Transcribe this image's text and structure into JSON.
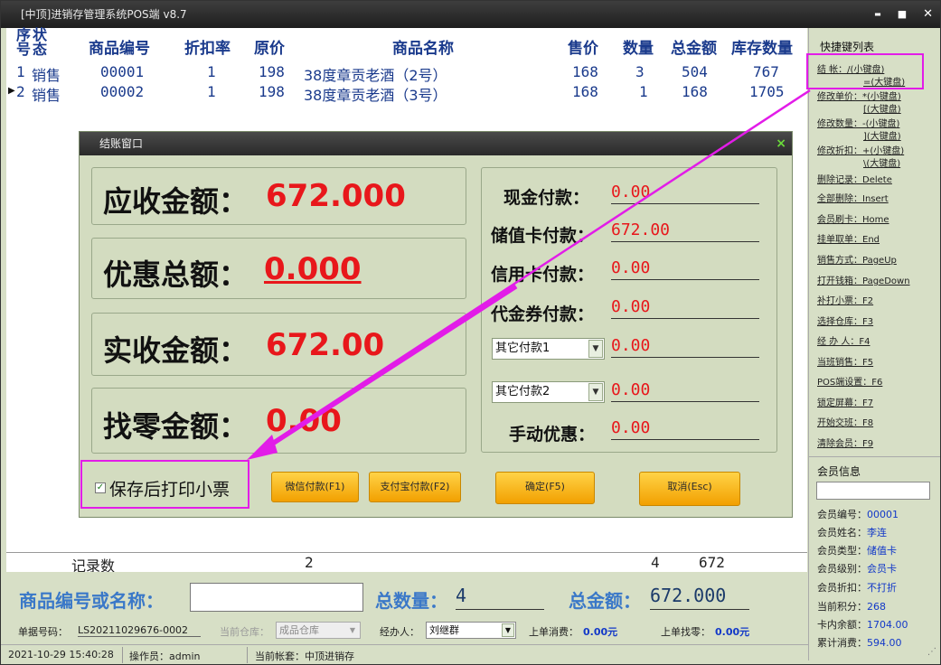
{
  "window": {
    "title": "[中顶]进销存管理系统POS端 v8.7",
    "min": "▬",
    "max": "■",
    "close": "✕"
  },
  "grid": {
    "headers": {
      "seq": "序号",
      "status": "状态",
      "code": "商品编号",
      "discount": "折扣率",
      "price": "原价",
      "name": "商品名称",
      "sale_price": "售价",
      "qty": "数量",
      "total": "总金额",
      "stock": "库存数量"
    },
    "rows": [
      {
        "seq": "1",
        "status": "销售",
        "code": "00001",
        "discount": "1",
        "price": "198",
        "name": "38度章贡老酒（2号）",
        "sale_price": "168",
        "qty": "3",
        "total": "504",
        "stock": "767"
      },
      {
        "seq": "2",
        "status": "销售",
        "code": "00002",
        "discount": "1",
        "price": "198",
        "name": "38度章贡老酒（3号）",
        "sale_price": "168",
        "qty": "1",
        "total": "168",
        "stock": "1705"
      }
    ],
    "footer": {
      "label": "记录数",
      "count": "2",
      "qty": "4",
      "total": "672"
    }
  },
  "dialog": {
    "title": "结账窗口",
    "close": "×",
    "receivable_label": "应收金额：",
    "receivable_value": "672.000",
    "discount_label": "优惠总额：",
    "discount_value": "0.000",
    "actual_label": "实收金额：",
    "actual_value": "672.00",
    "change_label": "找零金额：",
    "change_value": "0.00",
    "payments": [
      {
        "label": "现金付款：",
        "value": "0.00"
      },
      {
        "label": "储值卡付款：",
        "value": "672.00"
      },
      {
        "label": "信用卡付款：",
        "value": "0.00"
      },
      {
        "label": "代金券付款：",
        "value": "0.00"
      }
    ],
    "other1": {
      "select": "其它付款1",
      "value": "0.00"
    },
    "other2": {
      "select": "其它付款2",
      "value": "0.00"
    },
    "manual": {
      "label": "手动优惠：",
      "value": "0.00"
    },
    "print_checkbox": "保存后打印小票",
    "buttons": {
      "wechat": "微信付款(F1)",
      "alipay": "支付宝付款(F2)",
      "ok": "确定(F5)",
      "cancel": "取消(Esc)"
    }
  },
  "shortcuts": {
    "title": "快捷键列表",
    "items": [
      "结    帐：/(小键盘)",
      "=(大键盘)",
      "修改单价：*(小键盘)",
      "[(大键盘)",
      "修改数量：-(小键盘)",
      "](大键盘)",
      "修改折扣：+(小键盘)",
      "\\(大键盘)",
      "删除记录：Delete",
      "全部删除：Insert",
      "会员刷卡：Home",
      "挂单取单：End",
      "销售方式：PageUp",
      "打开钱箱：PageDown",
      "补打小票：F2",
      "选择仓库：F3",
      "经 办 人：F4",
      "当班销售：F5",
      "POS端设置：F6",
      "锁定屏幕：F7",
      "开始交班：F8",
      "清除会员：F9"
    ]
  },
  "member": {
    "title": "会员信息",
    "search_value": "",
    "fields": [
      {
        "label": "会员编号：",
        "value": "00001"
      },
      {
        "label": "会员姓名：",
        "value": "李连"
      },
      {
        "label": "会员类型：",
        "value": "储值卡"
      },
      {
        "label": "会员级别：",
        "value": "会员卡"
      },
      {
        "label": "会员折扣：",
        "value": "不打折"
      },
      {
        "label": "当前积分：",
        "value": "268"
      },
      {
        "label": "卡内余额：",
        "value": "1704.00"
      },
      {
        "label": "累计消费：",
        "value": "594.00"
      }
    ]
  },
  "bottom": {
    "search_label": "商品编号或名称：",
    "search_value": "",
    "qty_label": "总数量：",
    "qty_value": "4",
    "amount_label": "总金额：",
    "amount_value": "672.000"
  },
  "status": {
    "doc_label": "单据号码：",
    "doc_value": "LS20211029676-0002",
    "warehouse_label": "当前仓库：",
    "warehouse_value": "成品仓库",
    "handler_label": "经办人：",
    "handler_value": "刘继群",
    "last_spend_label": "上单消费：",
    "last_spend_value": "0.00元",
    "last_change_label": "上单找零：",
    "last_change_value": "0.00元",
    "datetime": "2021-10-29 15:40:28",
    "operator": "操作员：admin",
    "account": "当前帐套：中顶进销存"
  },
  "colors": {
    "accent_red": "#e8171b",
    "highlight_magenta": "#e21ce8",
    "button_orange": "#f2a000"
  }
}
